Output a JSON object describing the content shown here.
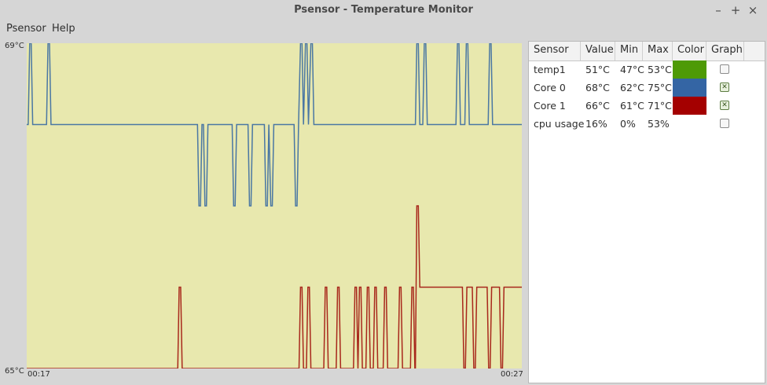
{
  "window": {
    "title": "Psensor - Temperature Monitor",
    "minimize_icon": "minimize-icon",
    "maximize_icon": "maximize-icon",
    "close_icon": "close-icon",
    "minimize_glyph": "–",
    "maximize_glyph": "+",
    "close_glyph": "×"
  },
  "menu": {
    "items": [
      "Psensor",
      "Help"
    ]
  },
  "graph": {
    "background": "#e8e8ae",
    "y_max_label": "69°C",
    "y_min_label": "65°C",
    "x_start_label": "00:17",
    "x_end_label": "00:27"
  },
  "chart_data": {
    "type": "line",
    "ylim": [
      65,
      69
    ],
    "x_start": "00:17",
    "x_end": "00:27",
    "series": [
      {
        "name": "Core 0",
        "color": "#4a77a3",
        "points": [
          [
            0.0,
            68
          ],
          [
            0.003,
            68
          ],
          [
            0.006,
            69
          ],
          [
            0.009,
            69
          ],
          [
            0.012,
            68
          ],
          [
            0.04,
            68
          ],
          [
            0.043,
            69
          ],
          [
            0.046,
            69
          ],
          [
            0.049,
            68
          ],
          [
            0.345,
            68
          ],
          [
            0.348,
            67
          ],
          [
            0.351,
            67
          ],
          [
            0.354,
            68
          ],
          [
            0.357,
            68
          ],
          [
            0.36,
            67
          ],
          [
            0.363,
            67
          ],
          [
            0.366,
            68
          ],
          [
            0.415,
            68
          ],
          [
            0.418,
            67
          ],
          [
            0.421,
            67
          ],
          [
            0.424,
            68
          ],
          [
            0.447,
            68
          ],
          [
            0.45,
            67
          ],
          [
            0.453,
            67
          ],
          [
            0.456,
            68
          ],
          [
            0.48,
            68
          ],
          [
            0.483,
            67
          ],
          [
            0.486,
            67
          ],
          [
            0.489,
            68
          ],
          [
            0.493,
            67
          ],
          [
            0.496,
            67
          ],
          [
            0.499,
            68
          ],
          [
            0.54,
            68
          ],
          [
            0.543,
            67
          ],
          [
            0.546,
            67
          ],
          [
            0.549,
            68
          ],
          [
            0.553,
            69
          ],
          [
            0.556,
            69
          ],
          [
            0.559,
            68
          ],
          [
            0.563,
            69
          ],
          [
            0.566,
            69
          ],
          [
            0.569,
            68
          ],
          [
            0.574,
            69
          ],
          [
            0.577,
            69
          ],
          [
            0.58,
            68
          ],
          [
            0.785,
            68
          ],
          [
            0.788,
            69
          ],
          [
            0.791,
            69
          ],
          [
            0.794,
            68
          ],
          [
            0.8,
            68
          ],
          [
            0.803,
            69
          ],
          [
            0.806,
            69
          ],
          [
            0.809,
            68
          ],
          [
            0.867,
            68
          ],
          [
            0.87,
            69
          ],
          [
            0.873,
            69
          ],
          [
            0.876,
            68
          ],
          [
            0.885,
            68
          ],
          [
            0.888,
            69
          ],
          [
            0.891,
            69
          ],
          [
            0.894,
            68
          ],
          [
            0.932,
            68
          ],
          [
            0.935,
            69
          ],
          [
            0.938,
            69
          ],
          [
            0.941,
            68
          ],
          [
            1.0,
            68
          ]
        ]
      },
      {
        "name": "Core 1",
        "color": "#a8281c",
        "points": [
          [
            0.0,
            65
          ],
          [
            0.305,
            65
          ],
          [
            0.308,
            66
          ],
          [
            0.311,
            66
          ],
          [
            0.314,
            65
          ],
          [
            0.55,
            65
          ],
          [
            0.553,
            66
          ],
          [
            0.556,
            66
          ],
          [
            0.559,
            65
          ],
          [
            0.565,
            65
          ],
          [
            0.568,
            66
          ],
          [
            0.571,
            66
          ],
          [
            0.574,
            65
          ],
          [
            0.6,
            65
          ],
          [
            0.603,
            66
          ],
          [
            0.606,
            66
          ],
          [
            0.609,
            65
          ],
          [
            0.625,
            65
          ],
          [
            0.628,
            66
          ],
          [
            0.631,
            66
          ],
          [
            0.634,
            65
          ],
          [
            0.66,
            65
          ],
          [
            0.663,
            66
          ],
          [
            0.666,
            66
          ],
          [
            0.669,
            65
          ],
          [
            0.672,
            66
          ],
          [
            0.675,
            66
          ],
          [
            0.678,
            65
          ],
          [
            0.685,
            65
          ],
          [
            0.688,
            66
          ],
          [
            0.691,
            66
          ],
          [
            0.694,
            65
          ],
          [
            0.7,
            65
          ],
          [
            0.703,
            66
          ],
          [
            0.706,
            66
          ],
          [
            0.709,
            65
          ],
          [
            0.72,
            65
          ],
          [
            0.723,
            66
          ],
          [
            0.726,
            66
          ],
          [
            0.729,
            65
          ],
          [
            0.75,
            65
          ],
          [
            0.753,
            66
          ],
          [
            0.756,
            66
          ],
          [
            0.759,
            65
          ],
          [
            0.775,
            65
          ],
          [
            0.778,
            66
          ],
          [
            0.781,
            66
          ],
          [
            0.784,
            65
          ],
          [
            0.785,
            65
          ],
          [
            0.788,
            67
          ],
          [
            0.791,
            67
          ],
          [
            0.794,
            66
          ],
          [
            0.88,
            66
          ],
          [
            0.883,
            65
          ],
          [
            0.886,
            65
          ],
          [
            0.889,
            66
          ],
          [
            0.9,
            66
          ],
          [
            0.903,
            65
          ],
          [
            0.906,
            65
          ],
          [
            0.909,
            66
          ],
          [
            0.93,
            66
          ],
          [
            0.933,
            65
          ],
          [
            0.936,
            65
          ],
          [
            0.939,
            66
          ],
          [
            0.955,
            66
          ],
          [
            0.958,
            65
          ],
          [
            0.961,
            65
          ],
          [
            0.964,
            66
          ],
          [
            1.0,
            66
          ]
        ]
      }
    ]
  },
  "table": {
    "columns": [
      "Sensor",
      "Value",
      "Min",
      "Max",
      "Color",
      "Graph"
    ],
    "rows": [
      {
        "sensor": "temp1",
        "value": "51°C",
        "min": "47°C",
        "max": "53°C",
        "color": "#4e9a06",
        "graph": false
      },
      {
        "sensor": "Core 0",
        "value": "68°C",
        "min": "62°C",
        "max": "75°C",
        "color": "#3465a4",
        "graph": true
      },
      {
        "sensor": "Core 1",
        "value": "66°C",
        "min": "61°C",
        "max": "71°C",
        "color": "#a40000",
        "graph": true
      },
      {
        "sensor": "cpu usage",
        "value": "16%",
        "min": "0%",
        "max": "53%",
        "color": "#ffffff",
        "graph": false
      }
    ]
  }
}
